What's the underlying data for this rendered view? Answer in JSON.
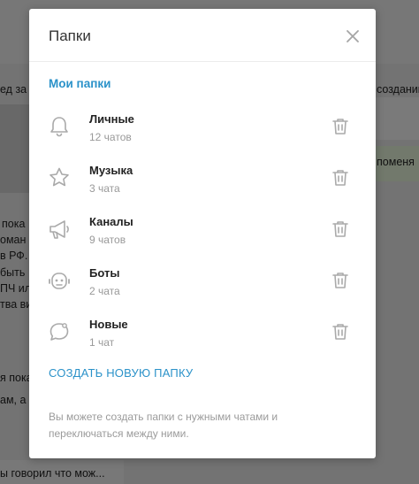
{
  "background": {
    "snippets": [
      "ед за м",
      "созданию",
      "пока",
      "оман",
      "в РФ.",
      "быть",
      "ПЧ или",
      "тва ви",
      "я пока",
      "ам, а",
      "ы говорил что мож...",
      "поменя"
    ]
  },
  "modal": {
    "title": "Папки",
    "section_title": "Мои папки",
    "folders": [
      {
        "name": "Личные",
        "count": "12 чатов",
        "icon": "bell-icon"
      },
      {
        "name": "Музыка",
        "count": "3 чата",
        "icon": "star-icon"
      },
      {
        "name": "Каналы",
        "count": "9 чатов",
        "icon": "megaphone-icon"
      },
      {
        "name": "Боты",
        "count": "2 чата",
        "icon": "bot-icon"
      },
      {
        "name": "Новые",
        "count": "1 чат",
        "icon": "chat-bubble-icon"
      }
    ],
    "create_label": "СОЗДАТЬ НОВУЮ ПАПКУ",
    "hint": "Вы можете создать папки с нужными чатами и переключаться между ними."
  },
  "colors": {
    "accent": "#2b92c9",
    "muted": "#999999",
    "overlay": "rgba(0,0,0,0.5)"
  }
}
